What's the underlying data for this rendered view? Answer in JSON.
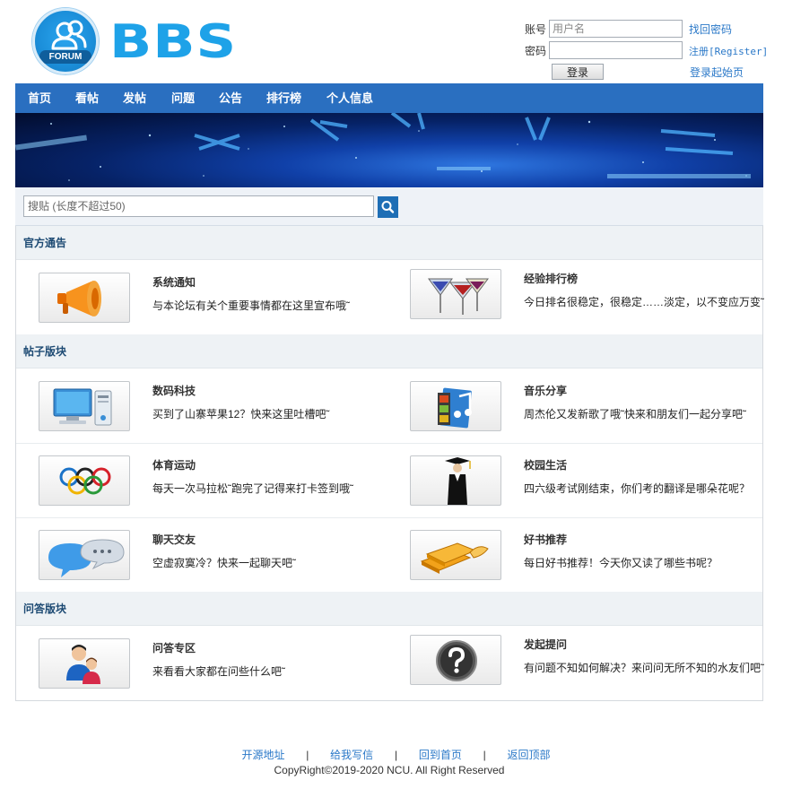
{
  "logo": {
    "badge_text": "FORUM",
    "brand_text": "BBS"
  },
  "login": {
    "account_label": "账号",
    "account_placeholder": "用户名",
    "password_label": "密码",
    "forgot_link": "找回密码",
    "register_link": "注册[Register]",
    "login_button": "登录",
    "homepage_link": "登录起始页"
  },
  "nav": [
    "首页",
    "看帖",
    "发帖",
    "问题",
    "公告",
    "排行榜",
    "个人信息"
  ],
  "search": {
    "placeholder": "搜贴 (长度不超过50)",
    "icon": "search-icon"
  },
  "sections": {
    "official": {
      "title": "官方通告",
      "forums": [
        {
          "title": "系统通知",
          "desc": "与本论坛有关个重要事情都在这里宣布哦˜",
          "icon": "megaphone-icon"
        },
        {
          "title": "经验排行榜",
          "desc": "今日排名很稳定，很稳定……淡定，以不变应万变˜",
          "icon": "cocktail-glasses-icon"
        }
      ]
    },
    "posts": {
      "title": "帖子版块",
      "forums": [
        {
          "title": "数码科技",
          "desc": "买到了山寨苹果12？快来这里吐槽吧˜",
          "icon": "computer-icon"
        },
        {
          "title": "音乐分享",
          "desc": "周杰伦又发新歌了哦˜快来和朋友们一起分享吧˜",
          "icon": "music-film-icon"
        },
        {
          "title": "体育运动",
          "desc": "每天一次马拉松˜跑完了记得来打卡签到哦˜",
          "icon": "olympic-rings-icon"
        },
        {
          "title": "校园生活",
          "desc": "四六级考试刚结束，你们考的翻译是哪朵花呢？",
          "icon": "graduate-icon"
        },
        {
          "title": "聊天交友",
          "desc": "空虚寂寞冷？快来一起聊天吧˜",
          "icon": "chat-bubbles-icon"
        },
        {
          "title": "好书推荐",
          "desc": "每日好书推荐！今天你又读了哪些书呢？",
          "icon": "books-icon"
        }
      ]
    },
    "qa": {
      "title": "问答版块",
      "forums": [
        {
          "title": "问答专区",
          "desc": "来看看大家都在问些什么吧˜",
          "icon": "users-icon"
        },
        {
          "title": "发起提问",
          "desc": "有问题不知如何解决？来问问无所不知的水友们吧˜",
          "icon": "question-icon"
        }
      ]
    }
  },
  "footer": {
    "links": [
      "开源地址",
      "给我写信",
      "回到首页",
      "返回顶部"
    ],
    "separator": "|",
    "copyright": "CopyRight©2019-2020 NCU. All Right Reserved"
  },
  "colors": {
    "nav": "#2a6fc0",
    "brand": "#1ea2e8",
    "link": "#2a78c8",
    "section_bg": "#eef2f5"
  }
}
